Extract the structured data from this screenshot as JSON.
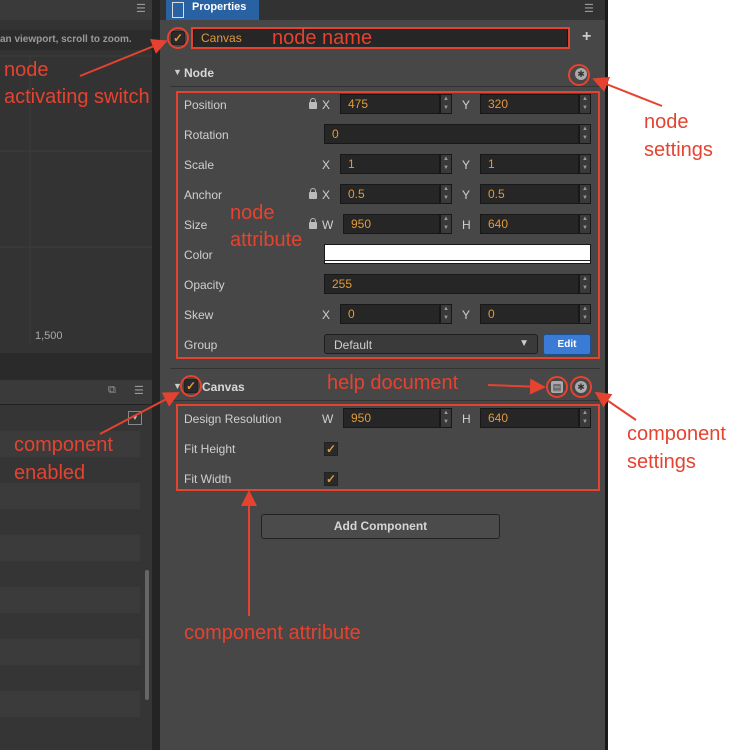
{
  "panel": {
    "tab_label": "Properties",
    "node_name": "Canvas",
    "add_icon": "plus-icon"
  },
  "viewport": {
    "hint": "an viewport, scroll to zoom.",
    "ruler_label": "1,500"
  },
  "node": {
    "title": "Node",
    "rows": {
      "position": {
        "label": "Position",
        "x_axis": "X",
        "x": "475",
        "y_axis": "Y",
        "y": "320"
      },
      "rotation": {
        "label": "Rotation",
        "value": "0"
      },
      "scale": {
        "label": "Scale",
        "x_axis": "X",
        "x": "1",
        "y_axis": "Y",
        "y": "1"
      },
      "anchor": {
        "label": "Anchor",
        "x_axis": "X",
        "x": "0.5",
        "y_axis": "Y",
        "y": "0.5"
      },
      "size": {
        "label": "Size",
        "w_axis": "W",
        "w": "950",
        "h_axis": "H",
        "h": "640"
      },
      "color": {
        "label": "Color",
        "value": "#ffffff"
      },
      "opacity": {
        "label": "Opacity",
        "value": "255"
      },
      "skew": {
        "label": "Skew",
        "x_axis": "X",
        "x": "0",
        "y_axis": "Y",
        "y": "0"
      },
      "group": {
        "label": "Group",
        "value": "Default",
        "edit_label": "Edit"
      }
    }
  },
  "canvas_component": {
    "title": "Canvas",
    "rows": {
      "design_resolution": {
        "label": "Design Resolution",
        "w_axis": "W",
        "w": "950",
        "h_axis": "H",
        "h": "640"
      },
      "fit_height": {
        "label": "Fit Height",
        "checked": true
      },
      "fit_width": {
        "label": "Fit Width",
        "checked": true
      }
    }
  },
  "add_component_label": "Add Component",
  "annotations": {
    "node_name": "node name",
    "node_activating_switch_1": "node",
    "node_activating_switch_2": "activating switch",
    "node_settings_1": "node",
    "node_settings_2": "settings",
    "node_attribute_1": "node",
    "node_attribute_2": "attribute",
    "help_document": "help document",
    "component_enabled_1": "component",
    "component_enabled_2": "enabled",
    "component_settings_1": "component",
    "component_settings_2": "settings",
    "component_attribute": "component attribute"
  },
  "colors": {
    "accent_blue": "#2962a3",
    "annotation_red": "#e5432f",
    "value_orange": "#e19a3c"
  }
}
